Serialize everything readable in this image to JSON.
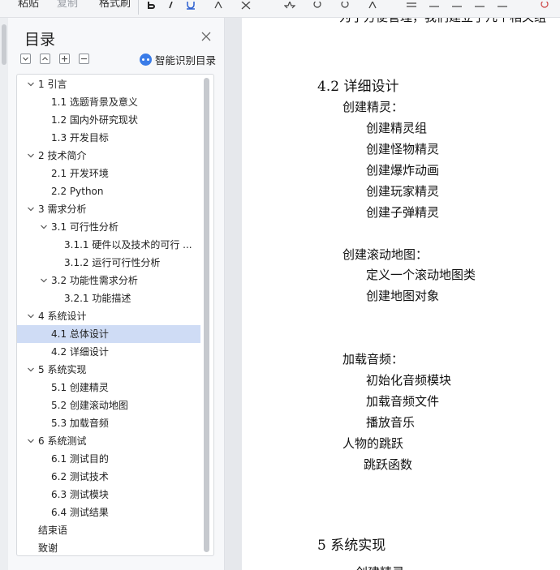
{
  "toolbar": {
    "item1": "粘贴",
    "item2": "复制",
    "item3": "格式刷"
  },
  "panel": {
    "title": "目录",
    "smart_label": "智能识别目录"
  },
  "toc": [
    {
      "text": "1  引言",
      "level": 1,
      "expanded": true
    },
    {
      "text": "1.1  选题背景及意义",
      "level": 2
    },
    {
      "text": "1.2  国内外研究现状",
      "level": 2
    },
    {
      "text": "1.3    开发目标",
      "level": 2
    },
    {
      "text": "2    技术简介",
      "level": 1,
      "expanded": true
    },
    {
      "text": "2.1  开发环境",
      "level": 2
    },
    {
      "text": "2.2  Python",
      "level": 2
    },
    {
      "text": "3  需求分析",
      "level": 1,
      "expanded": true
    },
    {
      "text": "3.1  可行性分析",
      "level": 2,
      "expanded": true
    },
    {
      "text": "3.1.1  硬件以及技术的可行 ...",
      "level": 3
    },
    {
      "text": "3.1.2  运行可行性分析",
      "level": 3
    },
    {
      "text": "3.2  功能性需求分析",
      "level": 2,
      "expanded": true
    },
    {
      "text": "3.2.1  功能描述",
      "level": 3
    },
    {
      "text": "4  系统设计",
      "level": 1,
      "expanded": true
    },
    {
      "text": "4.1  总体设计",
      "level": 2,
      "selected": true
    },
    {
      "text": "4.2  详细设计",
      "level": 2
    },
    {
      "text": "5  系统实现",
      "level": 1,
      "expanded": true
    },
    {
      "text": "5.1  创建精灵",
      "level": 2
    },
    {
      "text": "5.2  创建滚动地图",
      "level": 2
    },
    {
      "text": "5.3  加载音频",
      "level": 2
    },
    {
      "text": "6  系统测试",
      "level": 1,
      "expanded": true
    },
    {
      "text": "6.1  测试目的",
      "level": 2
    },
    {
      "text": "6.2  测试技术",
      "level": 2
    },
    {
      "text": "6.3  测试模块",
      "level": 2
    },
    {
      "text": "6.4  测试结果",
      "level": 2
    },
    {
      "text": "结束语",
      "level": 0
    },
    {
      "text": "致谢",
      "level": 0
    }
  ],
  "document": {
    "top_partial": "为了方便管理，我们建立了几个相关组",
    "heading_42": "4.2   详细设计",
    "l1": "创建精灵：",
    "l2": "创建精灵组",
    "l3": "创建怪物精灵",
    "l4": "创建爆炸动画",
    "l5": "创建玩家精灵",
    "l6": "创建子弹精灵",
    "l7": "创建滚动地图：",
    "l8": "定义一个滚动地图类",
    "l9": "创建地图对象",
    "l10": "加载音频：",
    "l11": "初始化音频模块",
    "l12": "加载音频文件",
    "l13": "播放音乐",
    "l14": "人物的跳跃",
    "l15": "跳跃函数",
    "heading_5": "5   系统实现",
    "bottom_partial": "创建精灵"
  },
  "colors": {
    "selected_bg": "#cfdcf5",
    "accent": "#3a7ce8"
  }
}
